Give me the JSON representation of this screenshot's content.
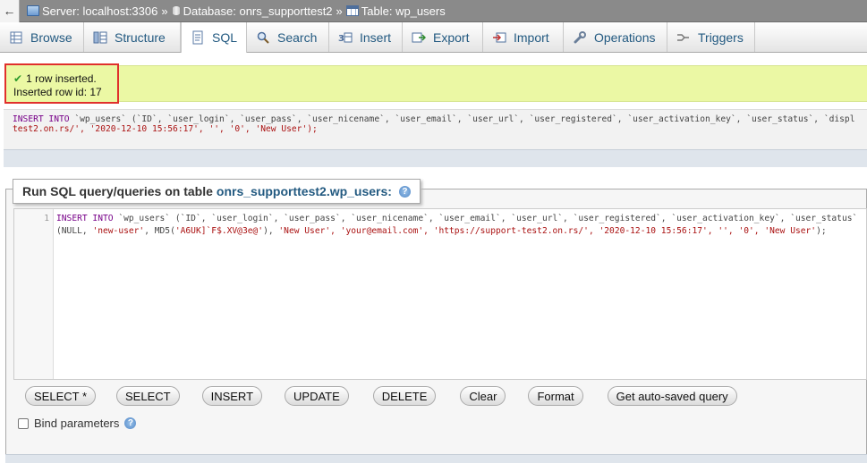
{
  "breadcrumb": {
    "back": "←",
    "server": "Server: localhost:3306",
    "database": "Database: onrs_supporttest2",
    "table": "Table: wp_users",
    "separator": "»"
  },
  "tabs": [
    {
      "label": "Browse",
      "icon": "browse-icon"
    },
    {
      "label": "Structure",
      "icon": "structure-icon"
    },
    {
      "label": "SQL",
      "icon": "sql-icon",
      "active": true
    },
    {
      "label": "Search",
      "icon": "search-icon"
    },
    {
      "label": "Insert",
      "icon": "insert-icon"
    },
    {
      "label": "Export",
      "icon": "export-icon"
    },
    {
      "label": "Import",
      "icon": "import-icon"
    },
    {
      "label": "Operations",
      "icon": "wrench-icon"
    },
    {
      "label": "Triggers",
      "icon": "triggers-icon"
    }
  ],
  "message": {
    "line1": "1 row inserted.",
    "line2": "Inserted row id: 17"
  },
  "sql_output": {
    "line1_kw": "INSERT INTO",
    "line1_rest": " `wp_users` (`ID`, `user_login`, `user_pass`, `user_nicename`, `user_email`, `user_url`, `user_registered`, `user_activation_key`, `user_status`, `displ",
    "line2": "test2.on.rs/', '2020-12-10 15:56:17', '', '0', 'New User');"
  },
  "panel": {
    "title": "Run SQL query/queries on table",
    "table_link": "onrs_supporttest2.wp_users:",
    "help": "?"
  },
  "editor": {
    "line_number": "1",
    "line1_kw": "INSERT INTO",
    "line1_rest": " `wp_users` (`ID`, `user_login`, `user_pass`, `user_nicename`, `user_email`, `user_url`, `user_registered`, `user_activation_key`, `user_status`",
    "line2_a": "(NULL, ",
    "line2_b": "'new-user'",
    "line2_c": ", MD5(",
    "line2_d": "'A6UK]`F$.XV@3e@'",
    "line2_e": "), ",
    "line2_f": "'New User', 'your@email.com', 'https://support-test2.on.rs/', '2020-12-10 15:56:17', '', '0', 'New User'",
    "line2_g": ");"
  },
  "buttons": [
    "SELECT *",
    "SELECT",
    "INSERT",
    "UPDATE",
    "DELETE",
    "Clear",
    "Format",
    "Get auto-saved query"
  ],
  "bind_parameters": "Bind parameters",
  "colors": {
    "success_bg": "#ebf8a4",
    "success_border": "#e0302c",
    "link": "#235a81"
  }
}
